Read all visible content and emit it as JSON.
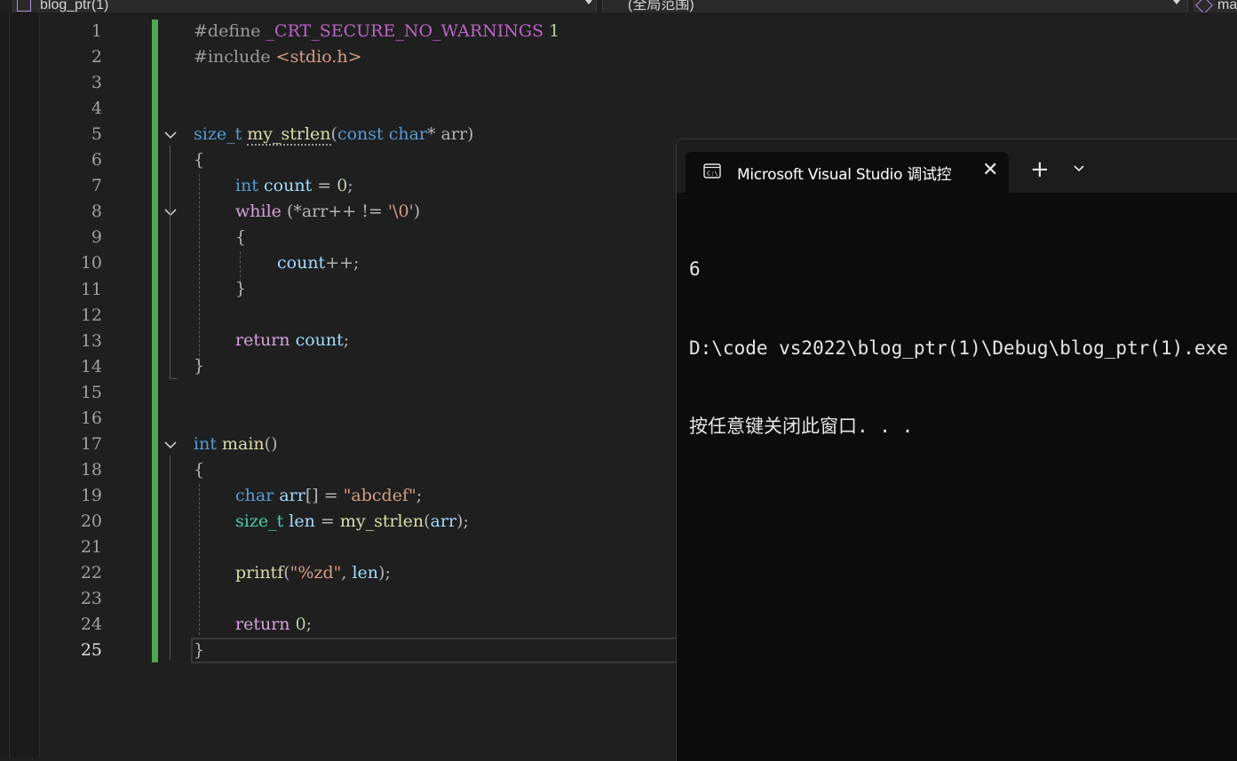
{
  "navbar": {
    "project_label": "blog_ptr(1)",
    "scope_label": "(全局范围)",
    "member_label": "ma"
  },
  "editor": {
    "line_numbers": [
      "1",
      "2",
      "3",
      "4",
      "5",
      "6",
      "7",
      "8",
      "9",
      "10",
      "11",
      "12",
      "13",
      "14",
      "15",
      "16",
      "17",
      "18",
      "19",
      "20",
      "21",
      "22",
      "23",
      "24",
      "25"
    ],
    "active_line": "25",
    "code": {
      "l1_directive": "#define",
      "l1_macro": "_CRT_SECURE_NO_WARNINGS",
      "l1_value": "1",
      "l2_directive": "#include",
      "l2_header": "<stdio.h>",
      "l5_type": "size_t",
      "l5_name": "my_strlen",
      "l5_open": "(",
      "l5_const": "const",
      "l5_char": "char",
      "l5_rest": "* arr)",
      "brace_open": "{",
      "brace_close": "}",
      "l7_type": "int",
      "l7_var": "count",
      "l7_assign": " = ",
      "l7_num": "0",
      "l7_end": ";",
      "l8_kw": "while",
      "l8_mid": " (*arr++ != ",
      "l8_char": "'\\0'",
      "l8_end": ")",
      "l10_var": "count",
      "l10_rest": "++;",
      "return_kw": "return",
      "l13_var": "count",
      "l13_end": ";",
      "l17_type": "int",
      "l17_name": "main",
      "l17_paren": "()",
      "l19_type": "char",
      "l19_var": "arr",
      "l19_mid": "[] = ",
      "l19_str": "\"abcdef\"",
      "l19_end": ";",
      "l20_type": "size_t",
      "l20_var": "len",
      "l20_eq": " = ",
      "l20_fn": "my_strlen",
      "l20_open": "(",
      "l20_arg": "arr",
      "l20_end": ");",
      "l22_fn": "printf",
      "l22_open": "(",
      "l22_str": "\"%zd\"",
      "l22_comma": ", ",
      "l22_arg": "len",
      "l22_end": ");",
      "l24_num": "0",
      "l24_end": ";"
    }
  },
  "terminal": {
    "tab_title": "Microsoft Visual Studio 调试控",
    "close_glyph": "✕",
    "new_tab_glyph": "+",
    "output_lines": [
      "6",
      "D:\\code vs2022\\blog_ptr(1)\\Debug\\blog_ptr(1).exe",
      "按任意键关闭此窗口. . ."
    ]
  },
  "colors": {
    "editor_bg": "#1f1f1f",
    "change_bar": "#4ea84e",
    "keyword": "#569cd6",
    "function": "#dcdcaa",
    "string": "#d69d85",
    "terminal_bg": "#0c0c0c"
  }
}
